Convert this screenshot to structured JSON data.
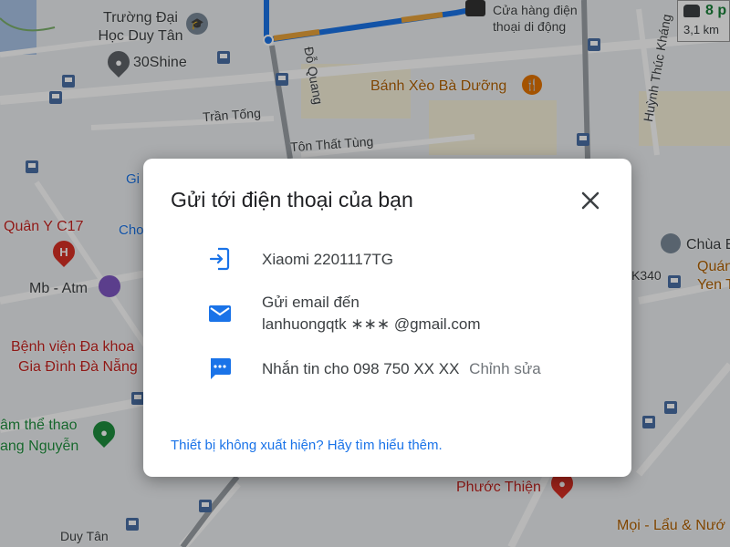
{
  "map": {
    "labels": {
      "truong_dai_hoc": "Trường Đại Học Duy Tân",
      "shine30": "30Shine",
      "cua_hang": "Cửa hàng điện thoại di động",
      "do_quang": "Đỗ Quang",
      "banh_xeo": "Bánh Xèo Bà Dưỡng",
      "huynh_thuc_khang": "Huỳnh Thúc Kháng",
      "tran_tong": "Trần Tống",
      "ton_that_tung": "Tôn Thất Tùng",
      "quan_y": "Quân Y C17",
      "mb_atm": "Mb - Atm",
      "benh_vien_1": "Bệnh viện Đa khoa",
      "benh_vien_2": "Gia Đình Đà Nẵng",
      "the_thao_1": "âm thể thao",
      "the_thao_2": "ang Nguyễn",
      "chua": "Chùa E",
      "k340": "K340",
      "quan_1": "Quán",
      "quan_2": "Yen T",
      "phuoc_thien": "Phước Thiện",
      "duy_tan": "Duy Tân",
      "moi_lau": "Mọi - Lẩu & Nướ",
      "partial_gi": "Gi",
      "partial_cho": "Cho"
    },
    "traffic": {
      "minutes": "8 p",
      "distance": "3,1 km"
    }
  },
  "dialog": {
    "title": "Gửi tới điện thoại của bạn",
    "device": "Xiaomi 2201117TG",
    "email_label": "Gửi email đến",
    "email_value": "lanhuongqtk ∗∗∗ @gmail.com",
    "sms_label": "Nhắn tin cho 098 750 XX XX",
    "sms_edit": "Chỉnh sửa",
    "help_link": "Thiết bị không xuất hiện? Hãy tìm hiểu thêm."
  },
  "colors": {
    "accent": "#1a73e8",
    "icon_blue": "#1a73e8"
  }
}
